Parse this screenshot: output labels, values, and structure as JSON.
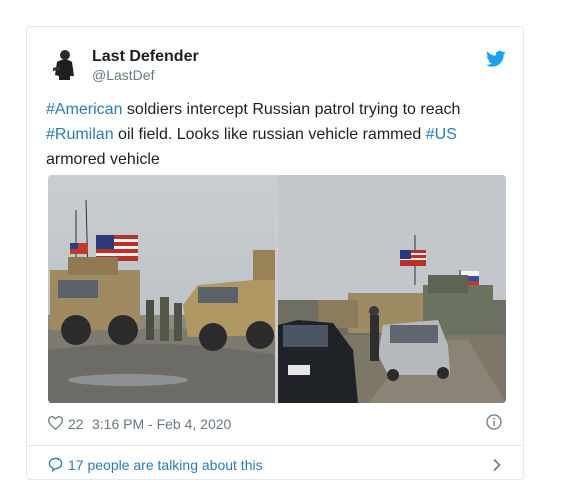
{
  "user": {
    "name": "Last Defender",
    "handle": "@LastDef"
  },
  "tweet": {
    "segments": [
      {
        "text": "#American",
        "type": "hashtag"
      },
      {
        "text": " soldiers intercept Russian patrol trying to reach ",
        "type": "text"
      },
      {
        "text": "#Rumilan",
        "type": "hashtag"
      },
      {
        "text": " oil field. Looks like russian vehicle rammed ",
        "type": "text"
      },
      {
        "text": "#US",
        "type": "hashtag"
      },
      {
        "text": " armored vehicle",
        "type": "text"
      }
    ]
  },
  "actions": {
    "like_count": "22",
    "timestamp": "3:16 PM - Feb 4, 2020"
  },
  "conversation": {
    "label": "17 people are talking about this"
  },
  "colors": {
    "link": "#2b7bb9",
    "text": "#1c2022",
    "muted": "#697882",
    "twitter": "#1da1f2",
    "border": "#e1e8ed"
  },
  "icons": {
    "logo": "twitter-bird-icon",
    "like": "heart-icon",
    "info": "info-icon",
    "conversation": "speech-bubble-icon",
    "more": "chevron-right-icon"
  }
}
